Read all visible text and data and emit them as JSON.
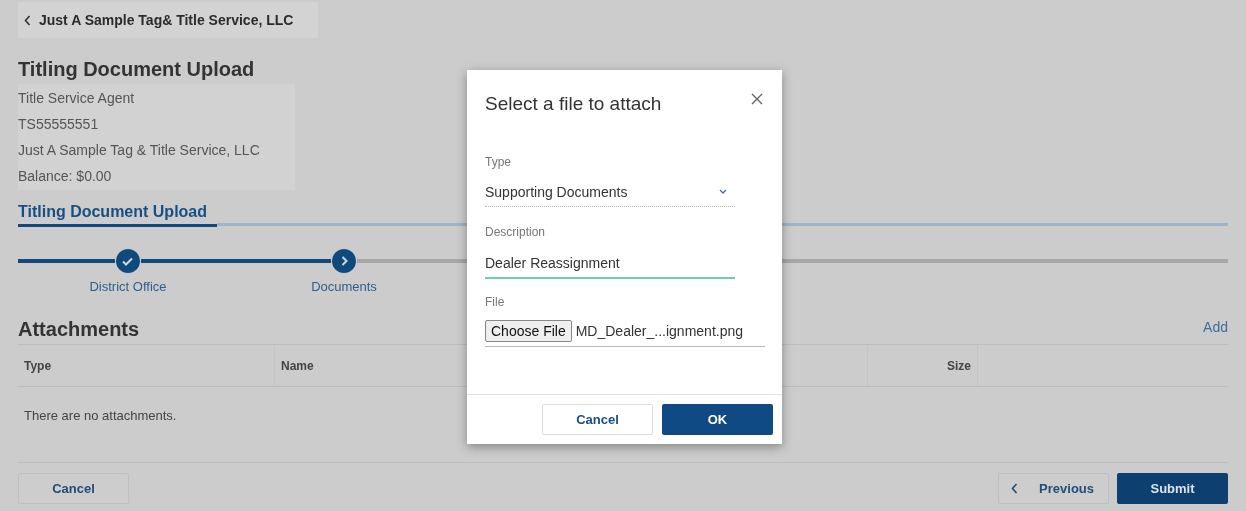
{
  "breadcrumb": {
    "label": "Just A Sample Tag& Title Service, LLC"
  },
  "page_title": "Titling Document Upload",
  "account_info": [
    "Title Service Agent",
    "TS55555551",
    "Just A Sample Tag & Title Service, LLC",
    "Balance: $0.00"
  ],
  "section_tab": {
    "label": "Titling Document Upload",
    "selected": true
  },
  "steps": [
    {
      "label": "District Office",
      "kind": "done"
    },
    {
      "label": "Documents",
      "kind": "current"
    }
  ],
  "attachments": {
    "title": "Attachments",
    "add_link": "Add",
    "columns": [
      {
        "label": "Type",
        "kind": "text"
      },
      {
        "label": "Name",
        "kind": "text"
      },
      {
        "label": "Size",
        "kind": "number"
      }
    ],
    "empty_message": "There are no attachments."
  },
  "footer": {
    "cancel": "Cancel",
    "previous": "Previous",
    "submit": "Submit"
  },
  "dialog": {
    "title": "Select a file to attach",
    "type_label": "Type",
    "type_value": "Supporting Documents",
    "description_label": "Description",
    "description_value": "Dealer Reassignment",
    "file_label": "File",
    "choose_file": "Choose File",
    "file_name": "MD_Dealer_...ignment.png",
    "cancel": "Cancel",
    "ok": "OK"
  }
}
